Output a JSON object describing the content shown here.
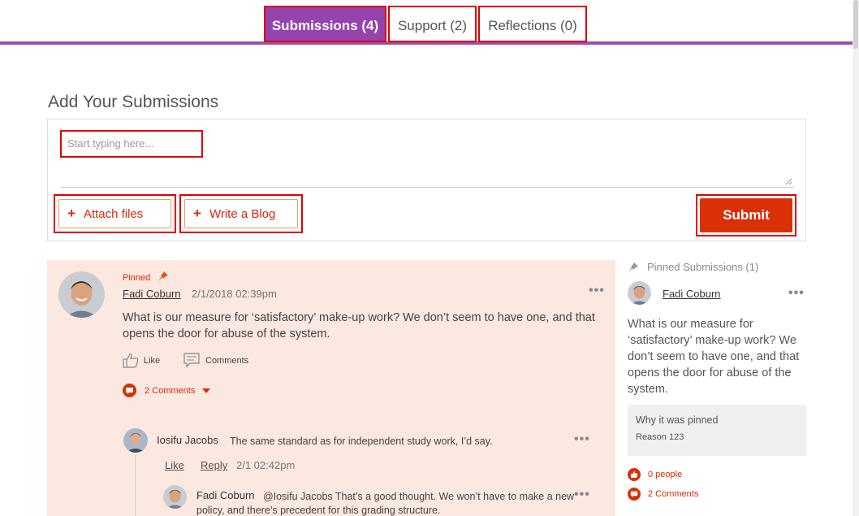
{
  "tabs": [
    {
      "label": "Submissions (4)",
      "active": true
    },
    {
      "label": "Support (2)",
      "active": false
    },
    {
      "label": "Reflections (0)",
      "active": false
    }
  ],
  "composer": {
    "title": "Add Your Submissions",
    "placeholder": "Start typing here...",
    "attach_label": "Attach files",
    "blog_label": "Write a Blog",
    "submit_label": "Submit"
  },
  "post": {
    "pinned_label": "Pinned",
    "author": "Fadi Coburn",
    "timestamp": "2/1/2018 02:39pm",
    "body": "What is our measure for ‘satisfactory’ make-up work? We don’t seem to have one, and that opens the door for abuse of the system.",
    "like_label": "Like",
    "comments_label": "Comments",
    "comments_toggle": "2 Comments"
  },
  "replies": [
    {
      "author": "Iosifu Jacobs",
      "text": "The same standard as for independent study work, I’d say.",
      "like_label": "Like",
      "reply_label": "Reply",
      "timestamp": "2/1 02:42pm"
    },
    {
      "author": "Fadi Coburn",
      "text": "@Iosifu Jacobs That’s a good thought. We won’t have to make a new policy, and there’s precedent for this grading structure."
    }
  ],
  "sidebar": {
    "header": "Pinned Submissions (1)",
    "author": "Fadi Coburn",
    "body": "What is our measure for ‘satisfactory’ make-up work? We don’t seem to have one, and that opens the door for abuse of the system.",
    "why_title": "Why it was pinned",
    "why_reason": "Reason 123",
    "people_stat": "0 people",
    "comments_stat": "2 Comments"
  },
  "colors": {
    "accent_purple": "#9444ad",
    "accent_red": "#d93008",
    "post_background": "#fbe8e0"
  }
}
